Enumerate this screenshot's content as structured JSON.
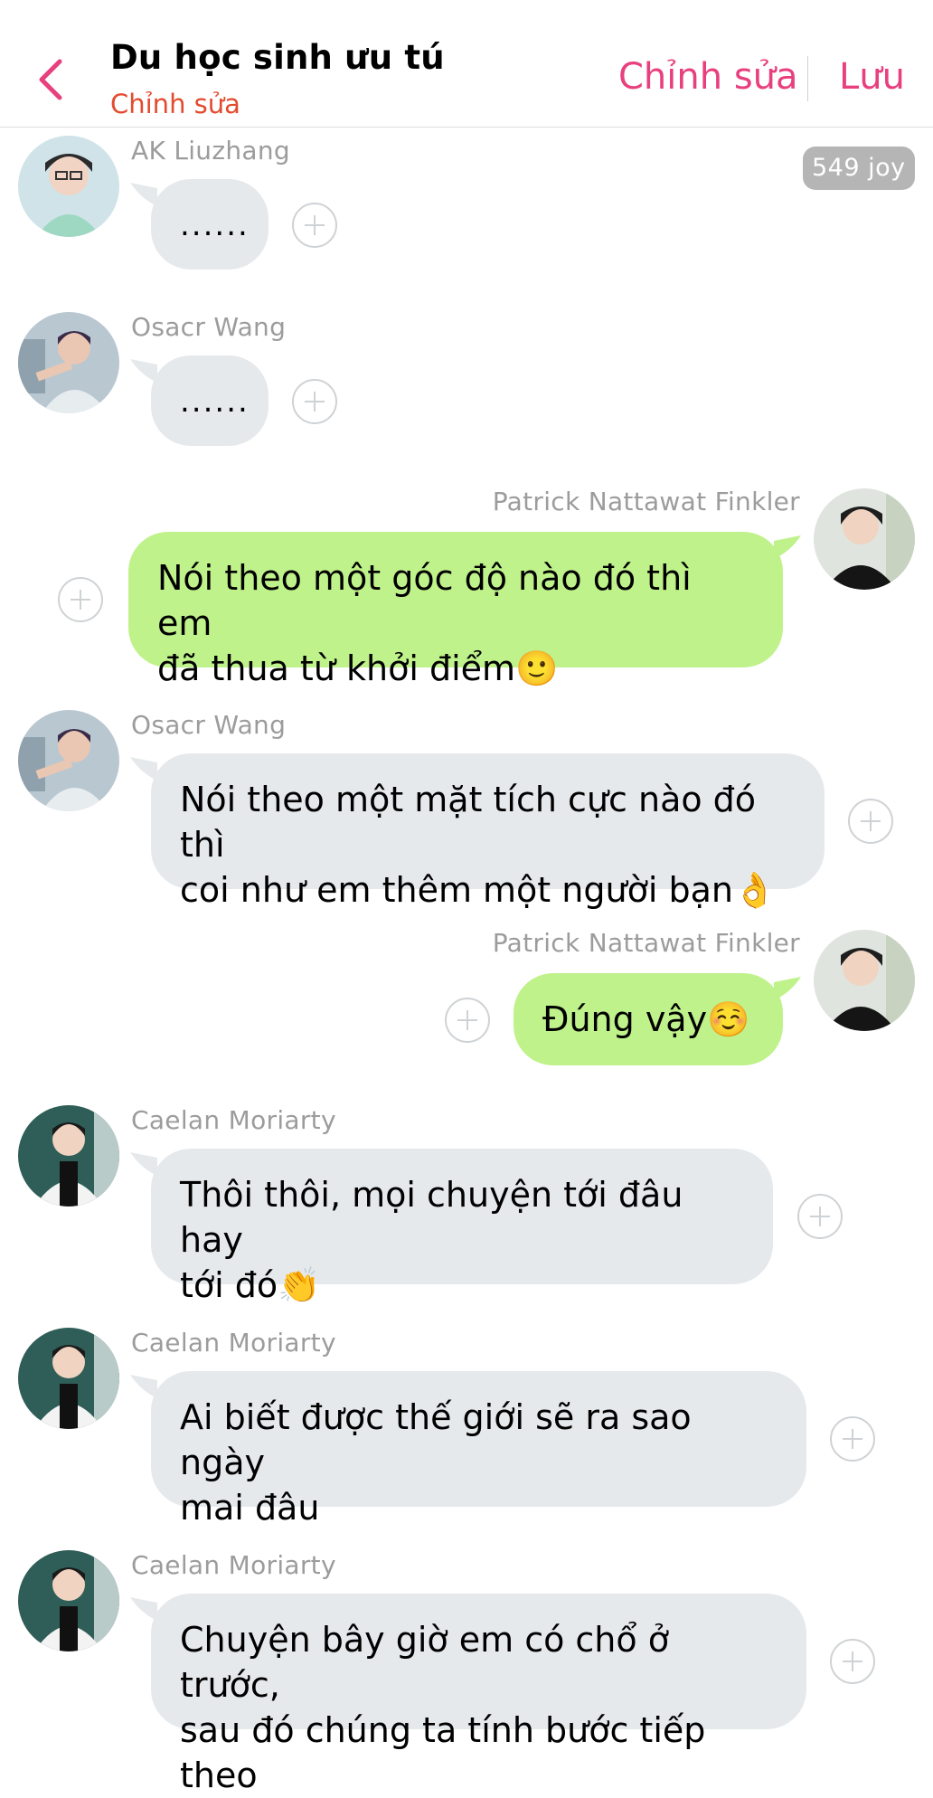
{
  "header": {
    "title": "Du học sinh ưu tú",
    "subtitle": "Chỉnh sửa",
    "edit_label": "Chỉnh sửa",
    "save_label": "Lưu",
    "back_icon": "chevron-left-icon",
    "accent_color": "#e8407e"
  },
  "badge": {
    "joy": "549 joy"
  },
  "messages": [
    {
      "sender": "AK Liuzhang",
      "side": "left",
      "text": "......"
    },
    {
      "sender": "Osacr Wang",
      "side": "left",
      "text": "......"
    },
    {
      "sender": "Patrick Nattawat Finkler",
      "side": "right",
      "text": "Nói theo một góc độ nào đó thì em\nđã thua từ khởi điểm🙂"
    },
    {
      "sender": "Osacr Wang",
      "side": "left",
      "text": "Nói theo một mặt tích cực nào đó thì\ncoi như em thêm một người bạn👌"
    },
    {
      "sender": "Patrick Nattawat Finkler",
      "side": "right",
      "text": "Đúng vậy☺️"
    },
    {
      "sender": "Caelan Moriarty",
      "side": "left",
      "text": "Thôi thôi, mọi chuyện tới đâu hay\ntới đó👏"
    },
    {
      "sender": "Caelan Moriarty",
      "side": "left",
      "text": "Ai biết được thế giới sẽ ra sao ngày\nmai đâu"
    },
    {
      "sender": "Caelan Moriarty",
      "side": "left",
      "text": "Chuyện bây giờ em có chổ ở trước,\nsau đó chúng ta tính bước tiếp theo"
    }
  ],
  "colors": {
    "left_bubble": "#e6e9ec",
    "right_bubble": "#bff28a",
    "name_text": "#9c9c9c"
  },
  "icons": {
    "add_reaction": "plus-circle-icon"
  }
}
